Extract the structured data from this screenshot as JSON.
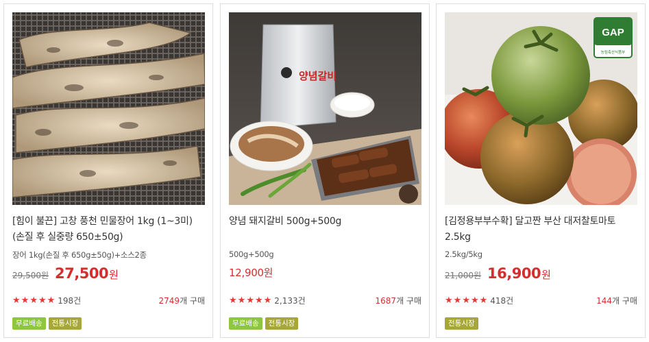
{
  "products": [
    {
      "title": "[힘이 불끈] 고창 풍천 민물장어 1kg (1~3미) (손질 후 실중량 650±50g)",
      "option": "장어 1kg(손질 후 650g±50g)+소스2종",
      "original_price": "29,500원",
      "sale_price": "27,500",
      "currency": "원",
      "rating": 5,
      "review_count": "198건",
      "purchase_count": "2749",
      "purchase_suffix": "개 구매",
      "badges": [
        "무료배송",
        "전통시장"
      ],
      "image": "grilled-eel"
    },
    {
      "title": "양념 돼지갈비 500g+500g",
      "option": "500g+500g",
      "original_price": "",
      "sale_price": "12,900원",
      "currency": "",
      "rating": 5,
      "review_count": "2,133건",
      "purchase_count": "1687",
      "purchase_suffix": "개 구매",
      "badges": [
        "무료배송",
        "전통시장"
      ],
      "image": "marinated-pork-ribs",
      "package_label": "양념갈비"
    },
    {
      "title": "[김정용부부수확] 달고짠 부산 대저찰토마토 2.5kg",
      "option": "2.5kg/5kg",
      "original_price": "21,000원",
      "sale_price": "16,900",
      "currency": "원",
      "rating": 5,
      "review_count": "418건",
      "purchase_count": "144",
      "purchase_suffix": "개 구매",
      "badges": [
        "전통시장"
      ],
      "image": "daejeo-tomatoes",
      "gap_label": "GAP",
      "gap_sub": "농림축산식품부"
    }
  ],
  "colors": {
    "price_red": "#d32f2f",
    "badge_free": "#8dc63f",
    "badge_market": "#a7a63a",
    "star": "#e53935"
  },
  "icons": {
    "star": "star-icon"
  }
}
